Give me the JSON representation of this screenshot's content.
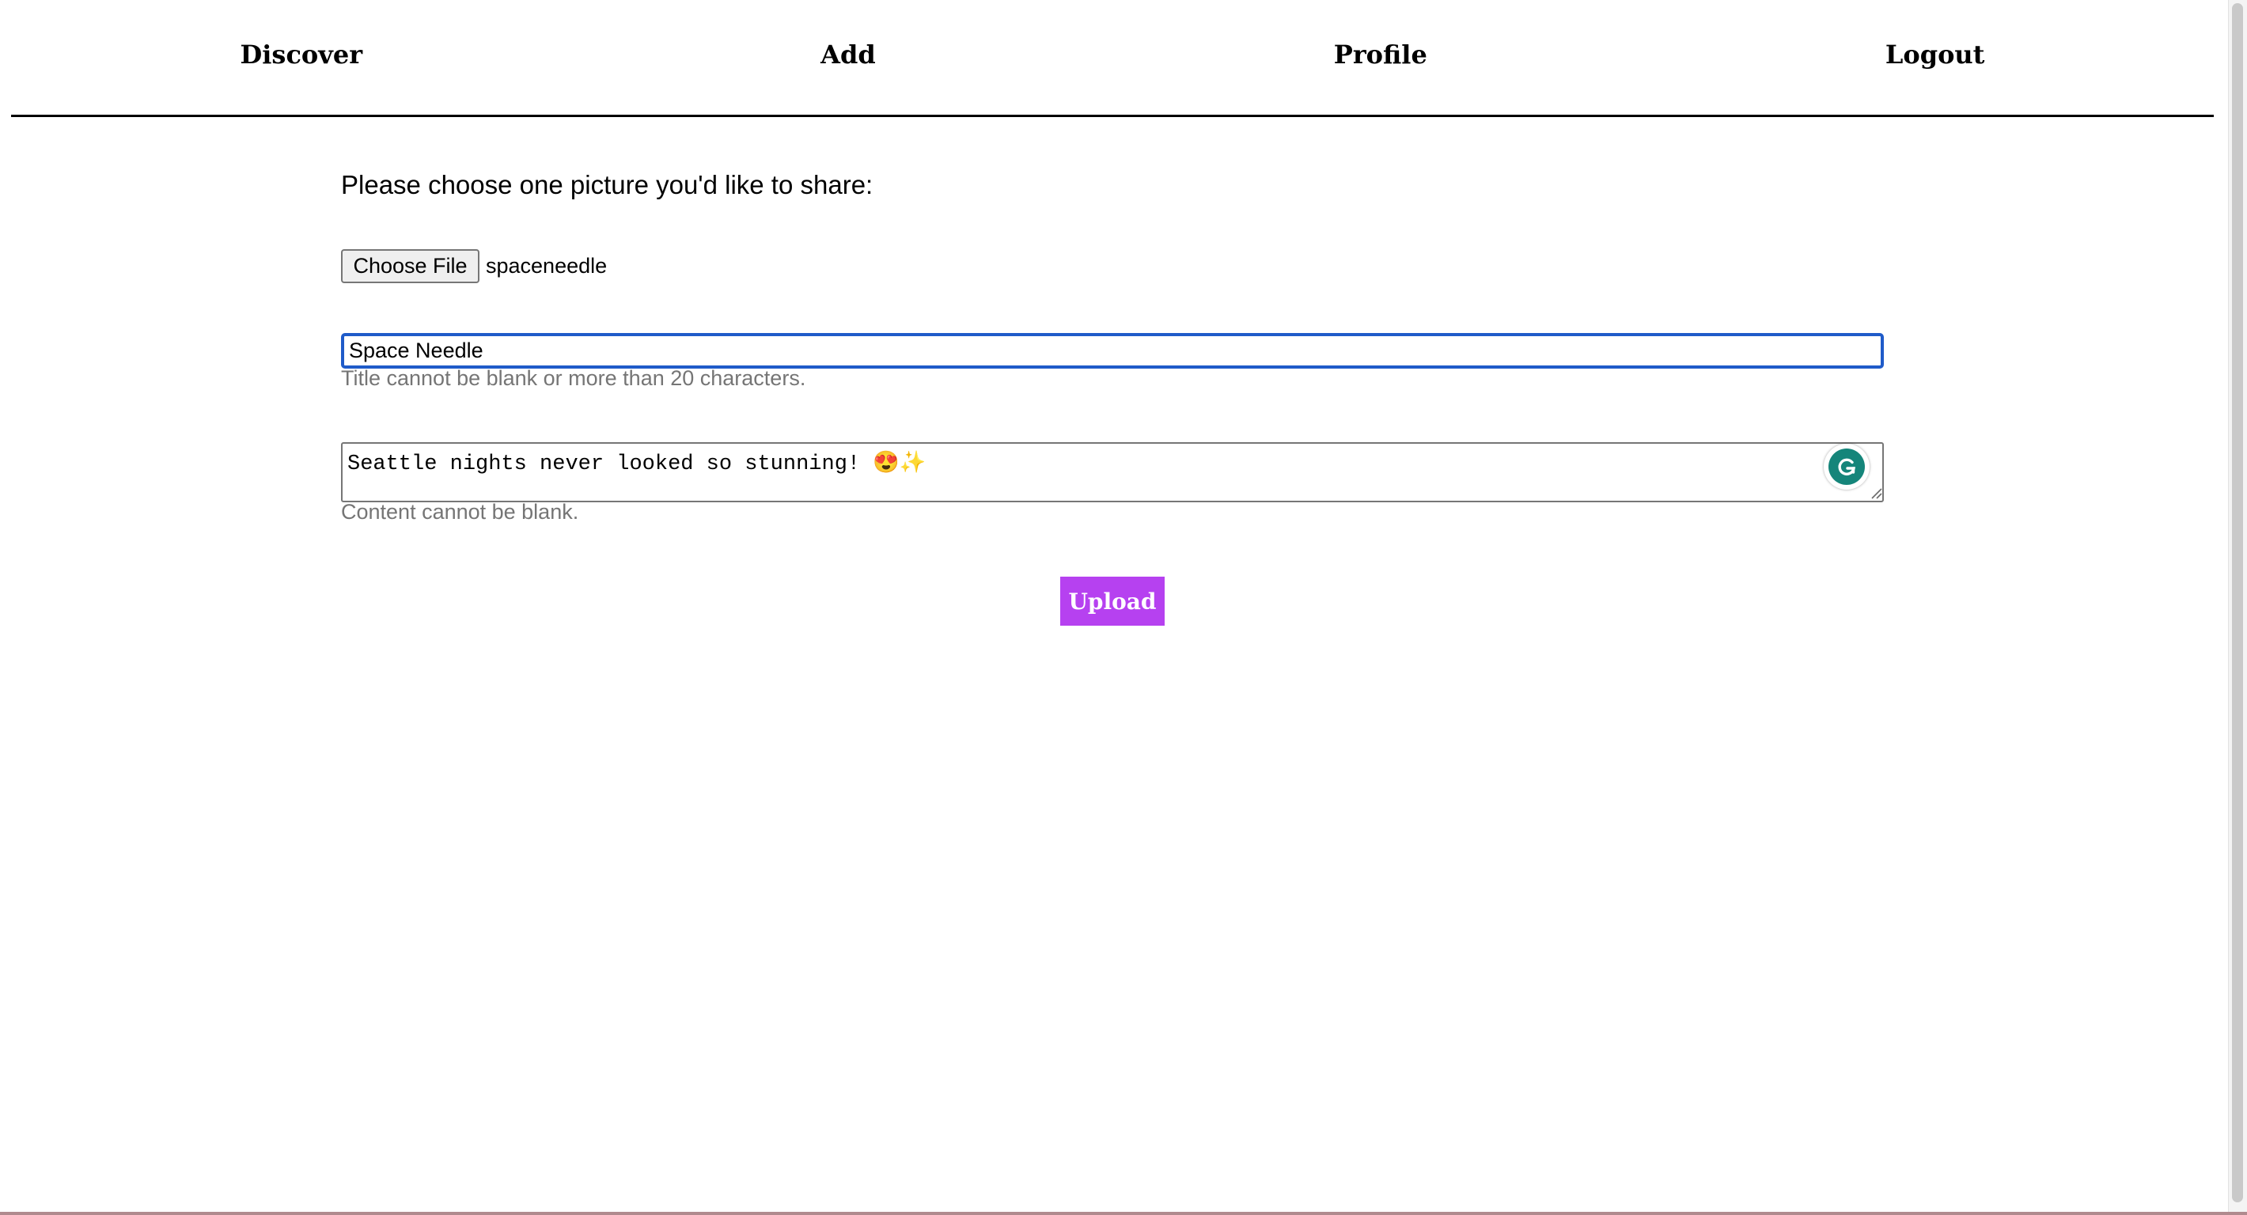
{
  "nav": {
    "items": [
      {
        "label": "Discover"
      },
      {
        "label": "Add"
      },
      {
        "label": "Profile"
      },
      {
        "label": "Logout"
      }
    ]
  },
  "form": {
    "prompt": "Please choose one picture you'd like to share:",
    "file": {
      "button_label": "Choose File",
      "selected_name": "spaceneedle"
    },
    "title": {
      "value": "Space Needle",
      "hint": "Title cannot be blank or more than 20 characters."
    },
    "content": {
      "value": "Seattle nights never looked so stunning! 😍✨",
      "hint": "Content cannot be blank."
    },
    "submit_label": "Upload"
  },
  "colors": {
    "accent": "#b641f0",
    "focus": "#1f5bc9",
    "hint": "#757575",
    "grammarly": "#15857a"
  },
  "icons": {
    "grammarly": "grammarly-g-icon",
    "resize": "resize-grip-icon"
  }
}
